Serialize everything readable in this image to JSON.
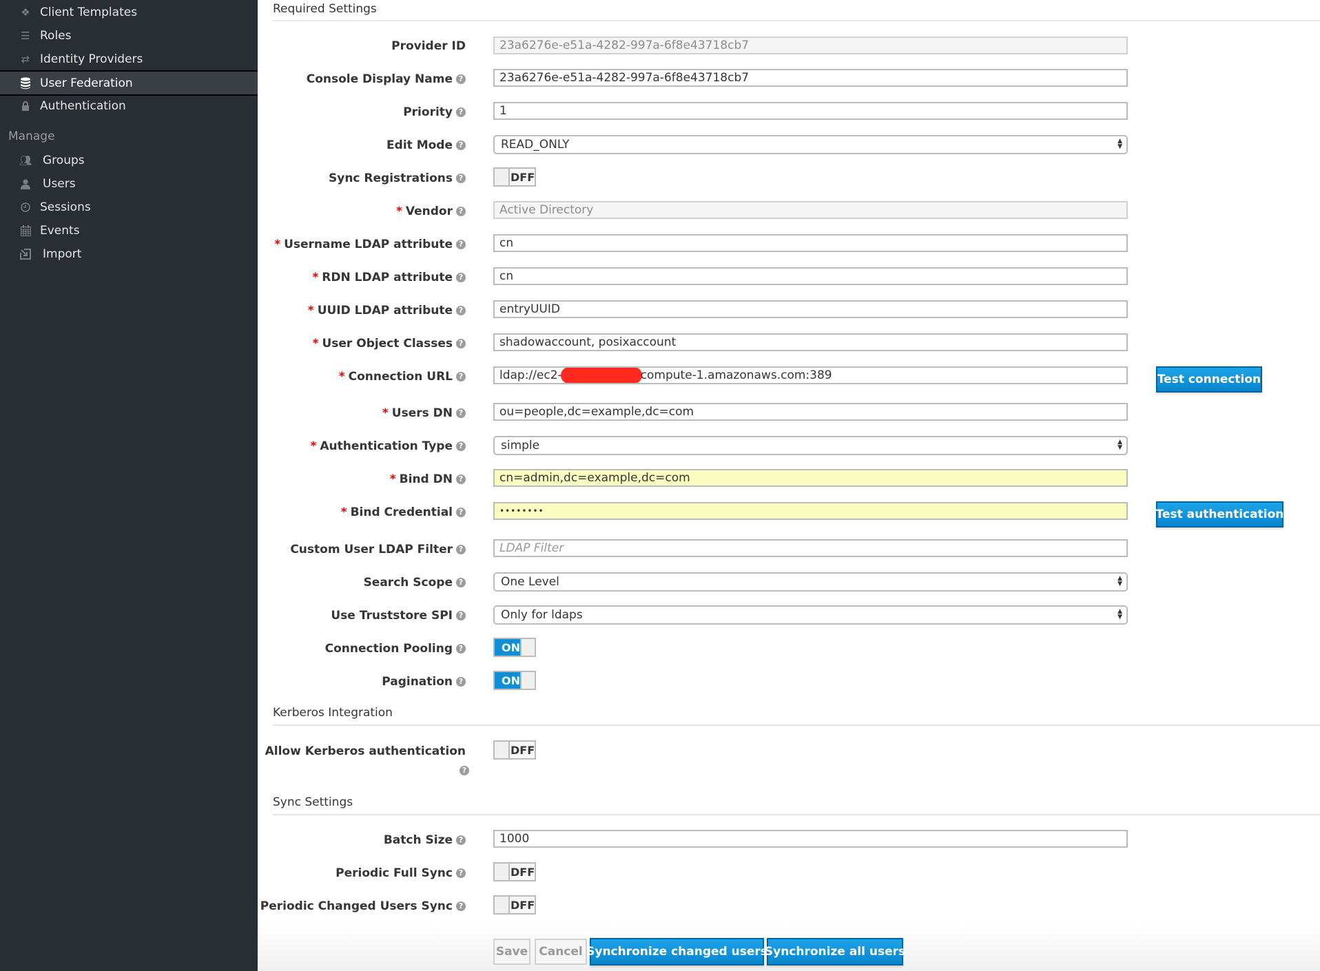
{
  "sidebar": {
    "items": [
      {
        "label": "Client Templates",
        "icon": "cubes-icon",
        "active": false
      },
      {
        "label": "Roles",
        "icon": "tasks-icon",
        "active": false
      },
      {
        "label": "Identity Providers",
        "icon": "exchange-icon",
        "active": false
      },
      {
        "label": "User Federation",
        "icon": "database-icon",
        "active": true
      },
      {
        "label": "Authentication",
        "icon": "lock-icon",
        "active": false
      }
    ],
    "manage_section": "Manage",
    "manage_items": [
      {
        "label": "Groups",
        "icon": "users-group-icon"
      },
      {
        "label": "Users",
        "icon": "user-icon"
      },
      {
        "label": "Sessions",
        "icon": "clock-icon"
      },
      {
        "label": "Events",
        "icon": "calendar-icon"
      },
      {
        "label": "Import",
        "icon": "import-icon"
      }
    ]
  },
  "sections": {
    "required": "Required Settings",
    "kerberos": "Kerberos Integration",
    "sync": "Sync Settings"
  },
  "fields": {
    "provider_id": {
      "label": "Provider ID",
      "value": "23a6276e-e51a-4282-997a-6f8e43718cb7"
    },
    "console_display_name": {
      "label": "Console Display Name",
      "value": "23a6276e-e51a-4282-997a-6f8e43718cb7"
    },
    "priority": {
      "label": "Priority",
      "value": "1"
    },
    "edit_mode": {
      "label": "Edit Mode",
      "value": "READ_ONLY"
    },
    "sync_registrations": {
      "label": "Sync Registrations",
      "value": "OFF"
    },
    "vendor": {
      "label": "Vendor",
      "value": "Active Directory"
    },
    "username_ldap_attribute": {
      "label": "Username LDAP attribute",
      "value": "cn"
    },
    "rdn_ldap_attribute": {
      "label": "RDN LDAP attribute",
      "value": "cn"
    },
    "uuid_ldap_attribute": {
      "label": "UUID LDAP attribute",
      "value": "entryUUID"
    },
    "user_object_classes": {
      "label": "User Object Classes",
      "value": "shadowaccount, posixaccount"
    },
    "connection_url": {
      "label": "Connection URL",
      "value_prefix": "ldap://ec2-",
      "value_suffix": "compute-1.amazonaws.com:389"
    },
    "users_dn": {
      "label": "Users DN",
      "value": "ou=people,dc=example,dc=com"
    },
    "authentication_type": {
      "label": "Authentication Type",
      "value": "simple"
    },
    "bind_dn": {
      "label": "Bind DN",
      "value": "cn=admin,dc=example,dc=com"
    },
    "bind_credential": {
      "label": "Bind Credential",
      "value": "••••••••"
    },
    "custom_user_ldap_filter": {
      "label": "Custom User LDAP Filter",
      "placeholder": "LDAP Filter"
    },
    "search_scope": {
      "label": "Search Scope",
      "value": "One Level"
    },
    "use_truststore_spi": {
      "label": "Use Truststore SPI",
      "value": "Only for ldaps"
    },
    "connection_pooling": {
      "label": "Connection Pooling",
      "value": "ON"
    },
    "pagination": {
      "label": "Pagination",
      "value": "ON"
    },
    "allow_kerberos": {
      "label": "Allow Kerberos authentication",
      "value": "OFF"
    },
    "batch_size": {
      "label": "Batch Size",
      "value": "1000"
    },
    "periodic_full_sync": {
      "label": "Periodic Full Sync",
      "value": "OFF"
    },
    "periodic_changed_users_sync": {
      "label": "Periodic Changed Users Sync",
      "value": "OFF"
    }
  },
  "toggle_off_text": "DFF",
  "buttons": {
    "test_connection": "Test connection",
    "test_authentication": "Test authentication",
    "save": "Save",
    "cancel": "Cancel",
    "sync_changed": "Synchronize changed users",
    "sync_all": "Synchronize all users"
  },
  "colors": {
    "sidebar_bg": "#292e34",
    "primary": "#0f8fd6",
    "required_star": "#e00000",
    "autofill_yellow": "#fafdc0"
  }
}
